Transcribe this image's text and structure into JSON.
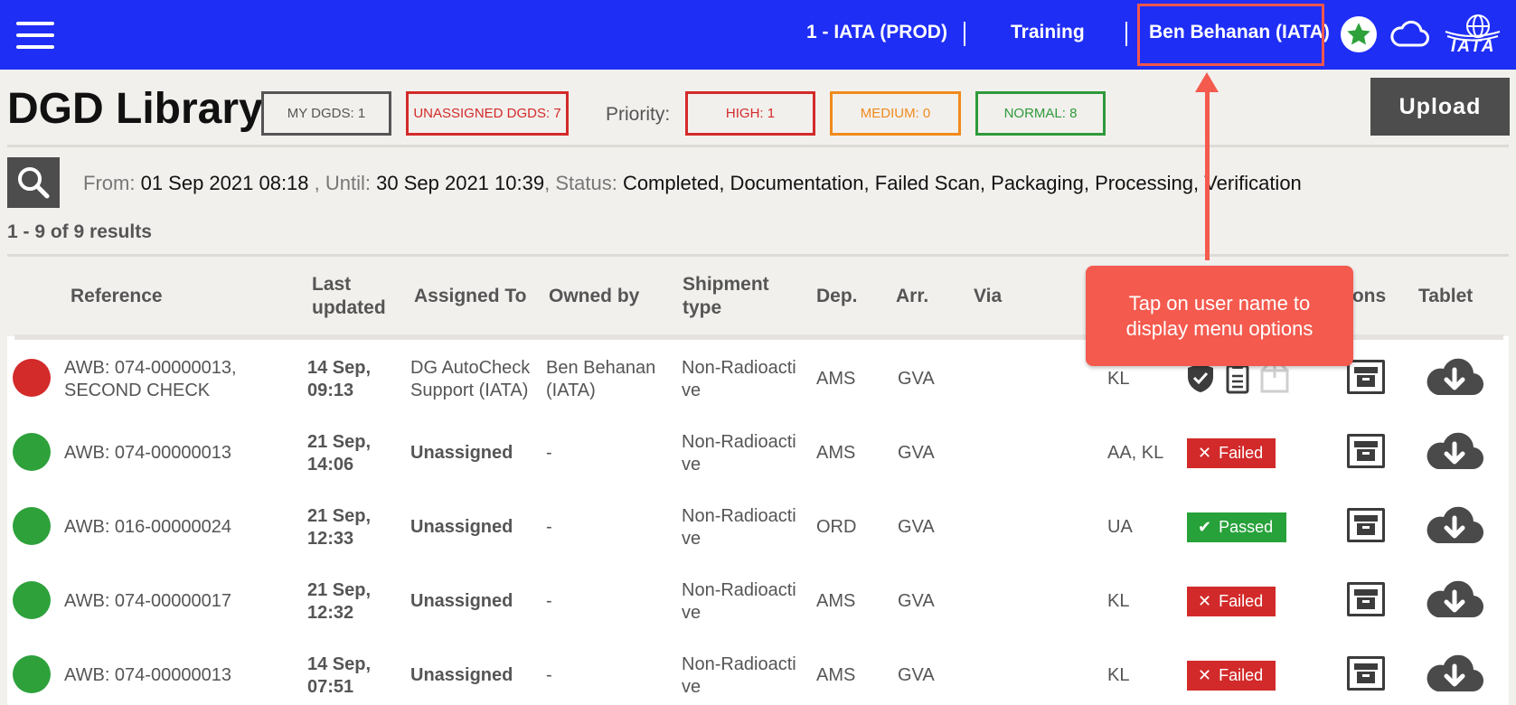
{
  "topbar": {
    "org": "1 - IATA (PROD)",
    "mode": "Training",
    "user": "Ben Behanan (IATA)",
    "logo_text": "IATA",
    "icons": [
      "menu-icon",
      "star-icon",
      "cloud-icon",
      "iata-globe-logo"
    ],
    "color": "#1f2ef5"
  },
  "header": {
    "title": "DGD Library",
    "my_dgds": "MY DGDS: 1",
    "unassigned_dgds": "UNASSIGNED DGDS: 7",
    "priority_label": "Priority:",
    "high": "HIGH: 1",
    "medium": "MEDIUM: 0",
    "normal": "NORMAL: 8",
    "upload": "Upload"
  },
  "filter": {
    "from_label": "From:",
    "from_value": "01 Sep 2021 08:18",
    "until_label": ", Until:",
    "until_value": "30 Sep 2021 10:39",
    "status_label": ", Status:",
    "status_value": "Completed, Documentation, Failed Scan, Packaging, Processing, Verification"
  },
  "results": "1 - 9 of 9 results",
  "columns": {
    "reference": "Reference",
    "last_updated_1": "Last",
    "last_updated_2": "updated",
    "assigned_to": "Assigned To",
    "owned_by": "Owned by",
    "shipment_1": "Shipment",
    "shipment_2": "type",
    "dep": "Dep.",
    "arr": "Arr.",
    "via": "Via",
    "options": "ions",
    "tablet": "Tablet"
  },
  "rows": [
    {
      "status_color": "#d32a2a",
      "ref1": "AWB: 074-00000013,",
      "ref2": "SECOND CHECK",
      "date1": "14 Sep,",
      "date2": "09:13",
      "assigned1": "DG AutoCheck",
      "assigned2": "Support (IATA)",
      "owned1": "Ben Behanan",
      "owned2": "(IATA)",
      "ship1": "Non-Radioacti",
      "ship2": "ve",
      "dep": "AMS",
      "arr": "GVA",
      "carrier": "KL",
      "result": ""
    },
    {
      "status_color": "#2ea13b",
      "ref1": "AWB: 074-00000013",
      "ref2": "",
      "date1": "21 Sep,",
      "date2": "14:06",
      "assigned1": "Unassigned",
      "assigned2": "",
      "owned1": "-",
      "owned2": "",
      "ship1": "Non-Radioacti",
      "ship2": "ve",
      "dep": "AMS",
      "arr": "GVA",
      "carrier": "AA, KL",
      "result": "Failed"
    },
    {
      "status_color": "#2ea13b",
      "ref1": "AWB: 016-00000024",
      "ref2": "",
      "date1": "21 Sep,",
      "date2": "12:33",
      "assigned1": "Unassigned",
      "assigned2": "",
      "owned1": "-",
      "owned2": "",
      "ship1": "Non-Radioacti",
      "ship2": "ve",
      "dep": "ORD",
      "arr": "GVA",
      "carrier": "UA",
      "result": "Passed"
    },
    {
      "status_color": "#2ea13b",
      "ref1": "AWB: 074-00000017",
      "ref2": "",
      "date1": "21 Sep,",
      "date2": "12:32",
      "assigned1": "Unassigned",
      "assigned2": "",
      "owned1": "-",
      "owned2": "",
      "ship1": "Non-Radioacti",
      "ship2": "ve",
      "dep": "AMS",
      "arr": "GVA",
      "carrier": "KL",
      "result": "Failed"
    },
    {
      "status_color": "#2ea13b",
      "ref1": "AWB: 074-00000013",
      "ref2": "",
      "date1": "14 Sep,",
      "date2": "07:51",
      "assigned1": "Unassigned",
      "assigned2": "",
      "owned1": "-",
      "owned2": "",
      "ship1": "Non-Radioacti",
      "ship2": "ve",
      "dep": "AMS",
      "arr": "GVA",
      "carrier": "KL",
      "result": "Failed"
    }
  ],
  "callout": {
    "line1": "Tap on user name to",
    "line2": "display menu options",
    "color": "#f45a4e"
  },
  "colors": {
    "failed": "#d22a2a",
    "passed": "#27a13a",
    "high": "#d32a2a",
    "medium": "#f08a1c",
    "normal": "#2e9a3a"
  }
}
